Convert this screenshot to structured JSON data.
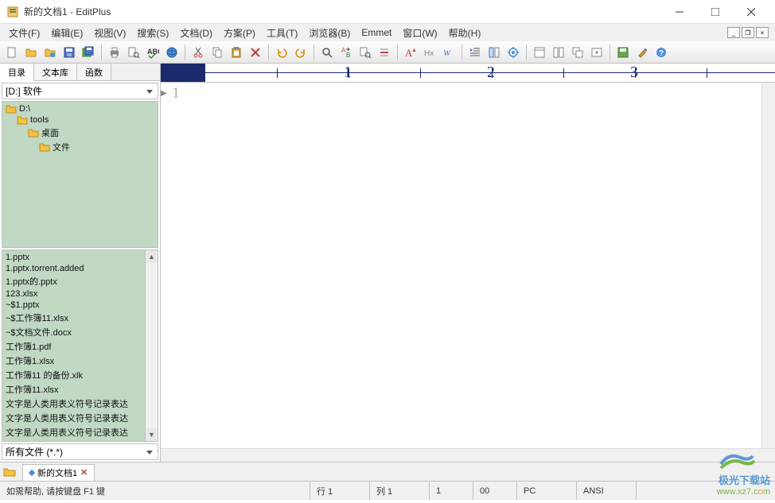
{
  "window": {
    "title": "新的文档1 - EditPlus"
  },
  "menu": {
    "file": "文件(F)",
    "edit": "编辑(E)",
    "view": "视图(V)",
    "search": "搜索(S)",
    "document": "文档(D)",
    "project": "方案(P)",
    "tools": "工具(T)",
    "browser": "浏览器(B)",
    "emmet": "Emmet",
    "window": "窗口(W)",
    "help": "帮助(H)"
  },
  "sidebar": {
    "tabs": {
      "dir": "目录",
      "clip": "文本库",
      "func": "函数"
    },
    "drive": "[D:] 软件",
    "tree": [
      {
        "indent": 0,
        "label": "D:\\"
      },
      {
        "indent": 1,
        "label": "tools"
      },
      {
        "indent": 2,
        "label": "桌面"
      },
      {
        "indent": 3,
        "label": "文件"
      }
    ],
    "files": [
      "1.pptx",
      "1.pptx.torrent.added",
      "1.pptx的.pptx",
      "123.xlsx",
      "~$1.pptx",
      "~$工作簿11.xlsx",
      "~$文档文件.docx",
      "工作簿1.pdf",
      "工作簿1.xlsx",
      "工作簿11 的备份.xlk",
      "工作簿11.xlsx",
      "文字是人类用表义符号记录表达",
      "文字是人类用表义符号记录表达",
      "文字是人类用表义符号记录表达"
    ],
    "filter": "所有文件 (*.*)"
  },
  "editor": {
    "ruler_numbers": [
      "1",
      "2",
      "3"
    ],
    "line_number": "1"
  },
  "doctab": {
    "name": "新的文档1"
  },
  "status": {
    "help": "如需帮助, 请按键盘 F1 键",
    "line": "行 1",
    "col": "列 1",
    "num": "1",
    "ovr": "00",
    "mode": "PC",
    "enc": "ANSI"
  },
  "watermark": {
    "line1": "极光下载站",
    "line2_a": "www.xz7.c",
    "line2_b": "o",
    "line2_c": "m"
  }
}
